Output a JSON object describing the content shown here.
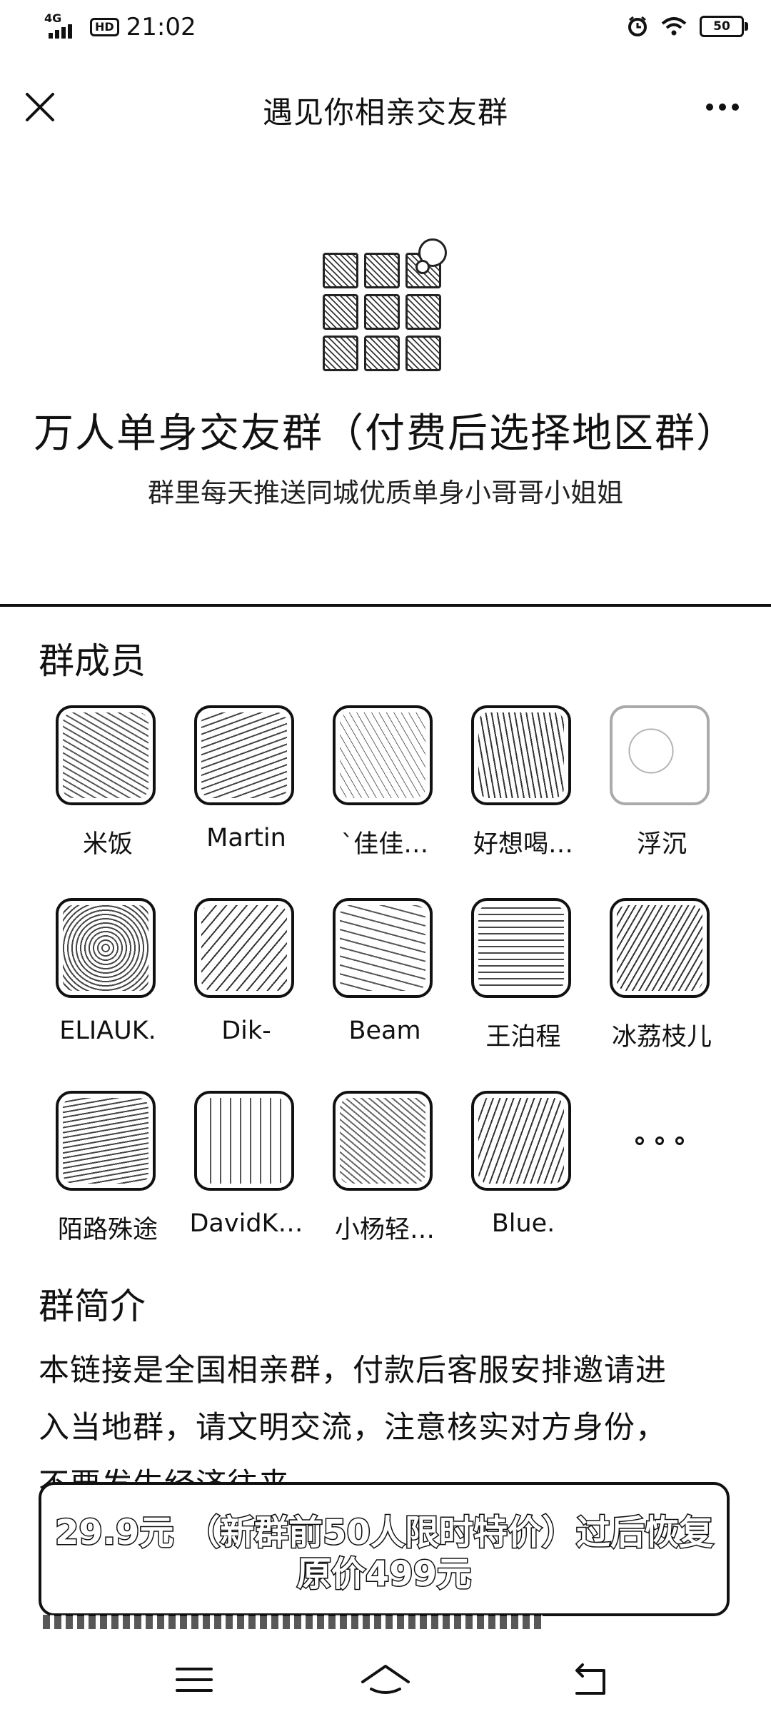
{
  "status_bar": {
    "time": "21:02",
    "network": "4G",
    "battery": "50"
  },
  "header": {
    "title": "遇见你相亲交友群"
  },
  "group": {
    "name": "万人单身交友群（付费后选择地区群）",
    "description": "群里每天推送同城优质单身小哥哥小姐姐"
  },
  "members_section": {
    "title": "群成员",
    "members": [
      {
        "name": "米饭"
      },
      {
        "name": "Martin"
      },
      {
        "name": "`佳佳…"
      },
      {
        "name": "好想喝…"
      },
      {
        "name": "浮沉"
      },
      {
        "name": "ELIAUK."
      },
      {
        "name": "Dik-"
      },
      {
        "name": "Beam"
      },
      {
        "name": "王泊程"
      },
      {
        "name": "冰荔枝儿"
      },
      {
        "name": "陌路殊途"
      },
      {
        "name": "DavidK…"
      },
      {
        "name": "小杨轻…"
      },
      {
        "name": "Blue."
      }
    ]
  },
  "intro_section": {
    "title": "群简介",
    "lines": [
      "本链接是全国相亲群，付款后客服安排邀请进",
      "入当地群，请文明交流，注意核实对方身份，",
      "不要发生经济往来。"
    ]
  },
  "price_banner": {
    "line1": "29.9元 （新群前50人限时特价）过后恢复",
    "line2": "原价499元"
  }
}
